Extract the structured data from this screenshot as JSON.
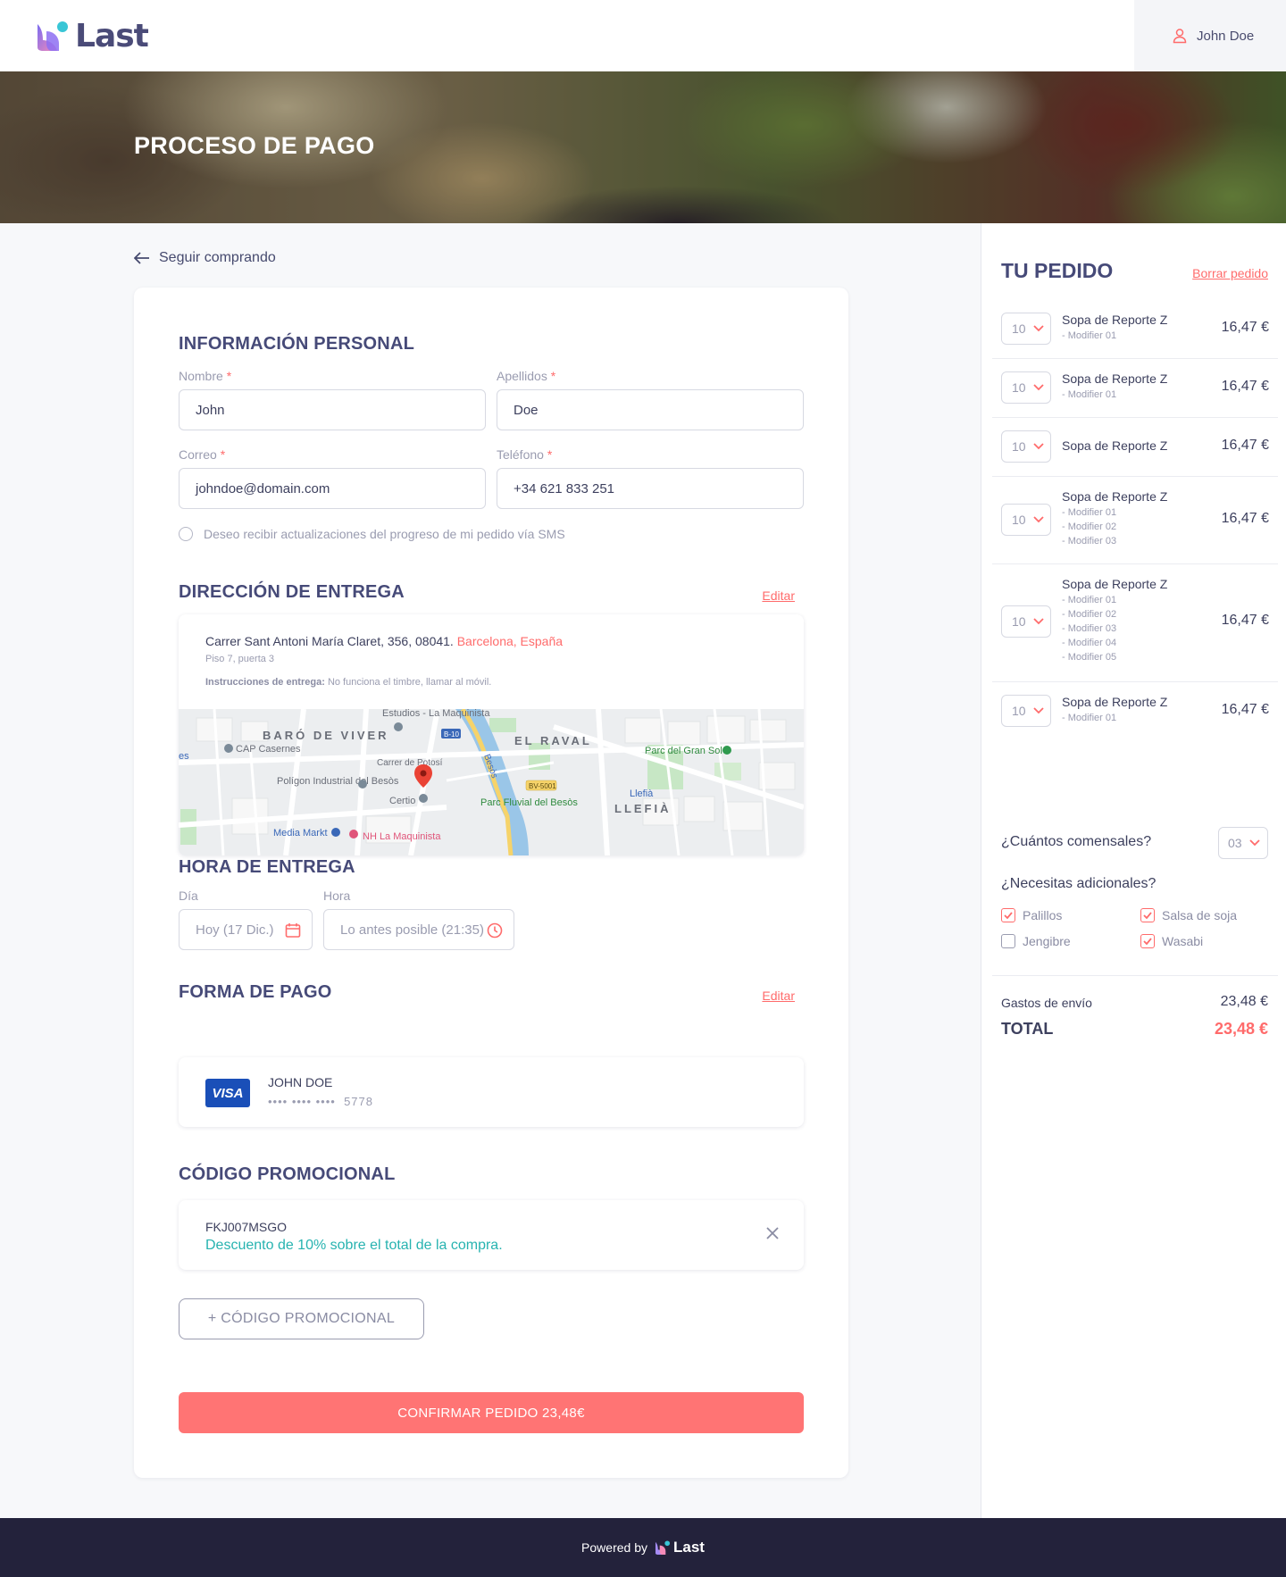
{
  "header": {
    "brand": "Last",
    "user_name": "John Doe"
  },
  "hero": {
    "title": "PROCESO DE PAGO"
  },
  "back_link": "Seguir comprando",
  "personal": {
    "title": "INFORMACIÓN PERSONAL",
    "first_name_label": "Nombre",
    "first_name_value": "John",
    "last_name_label": "Apellidos",
    "last_name_value": "Doe",
    "email_label": "Correo",
    "email_value": "johndoe@domain.com",
    "phone_label": "Teléfono",
    "phone_value": "+34 621 833 251",
    "required_mark": "*",
    "sms_option": "Deseo recibir actualizaciones del progreso de mi pedido vía SMS"
  },
  "delivery": {
    "title": "DIRECCIÓN DE ENTREGA",
    "edit_label": "Editar",
    "address": "Carrer Sant Antoni María Claret, 356, 08041.",
    "city": "Barcelona, España",
    "floor": "Piso 7, puerta 3",
    "instructions_label": "Instrucciones de entrega:",
    "instructions": "No funciona el timbre, llamar al móvil.",
    "map_labels": {
      "studios": "Estudios - La Maquinista",
      "baro": "BARÓ DE VIVER",
      "raval": "EL RAVAL",
      "cap": "CAP Casernes",
      "potosi": "Carrer de Potosí",
      "parc_sol": "Parc del Gran Sol",
      "poligon": "Polígon Industrial del Besòs",
      "certio": "Certio",
      "parc_fluvial": "Parc Fluvial del Besòs",
      "llefia_poi": "Llefià",
      "llefia": "LLEFIÀ",
      "media": "Media Markt",
      "nh": "NH La Maquinista",
      "b10": "B-10",
      "bv": "BV-5001",
      "besos": "Besòs",
      "les": "es"
    }
  },
  "time": {
    "title": "HORA DE ENTREGA",
    "day_label": "Día",
    "day_value": "Hoy (17 Dic.)",
    "hour_label": "Hora",
    "hour_value": "Lo antes posible (21:35)"
  },
  "payment": {
    "title": "FORMA DE PAGO",
    "edit_label": "Editar",
    "brand": "VISA",
    "holder": "JOHN DOE",
    "masked": "•••• •••• ••••",
    "last4": "5778"
  },
  "promo": {
    "title": "CÓDIGO PROMOCIONAL",
    "code": "FKJ007MSGO",
    "description": "Descuento de 10% sobre el total de la compra.",
    "add_label": "+ CÓDIGO PROMOCIONAL"
  },
  "confirm_label": "CONFIRMAR PEDIDO 23,48€",
  "order": {
    "title": "TU PEDIDO",
    "clear_label": "Borrar pedido",
    "items": [
      {
        "qty": "10",
        "name": "Sopa de Reporte Z",
        "modifiers": [
          "- Modifier 01"
        ],
        "price": "16,47 €"
      },
      {
        "qty": "10",
        "name": "Sopa de Reporte Z",
        "modifiers": [
          "- Modifier 01"
        ],
        "price": "16,47 €"
      },
      {
        "qty": "10",
        "name": "Sopa de Reporte Z",
        "modifiers": [],
        "price": "16,47 €"
      },
      {
        "qty": "10",
        "name": "Sopa de Reporte Z",
        "modifiers": [
          "- Modifier 01",
          "- Modifier 02",
          "- Modifier 03"
        ],
        "price": "16,47 €"
      },
      {
        "qty": "10",
        "name": "Sopa de Reporte Z",
        "modifiers": [
          "- Modifier 01",
          "- Modifier 02",
          "- Modifier 03",
          "- Modifier 04",
          "- Modifier 05"
        ],
        "price": "16,47 €"
      },
      {
        "qty": "10",
        "name": "Sopa de Reporte Z",
        "modifiers": [
          "- Modifier 01"
        ],
        "price": "16,47 €"
      }
    ],
    "diners_question": "¿Cuántos comensales?",
    "diners_value": "03",
    "extras_question": "¿Necesitas adicionales?",
    "extras": [
      {
        "label": "Palillos",
        "checked": true
      },
      {
        "label": "Salsa de soja",
        "checked": true
      },
      {
        "label": "Jengibre",
        "checked": false
      },
      {
        "label": "Wasabi",
        "checked": true
      }
    ],
    "shipping_label": "Gastos de envío",
    "shipping_value": "23,48 €",
    "total_label": "TOTAL",
    "total_value": "23,48 €"
  },
  "footer": {
    "powered_by": "Powered by",
    "brand": "Last"
  },
  "colors": {
    "accent": "#ff7474",
    "brand": "#464a78",
    "teal": "#27b3b0",
    "footer": "#23223b"
  }
}
